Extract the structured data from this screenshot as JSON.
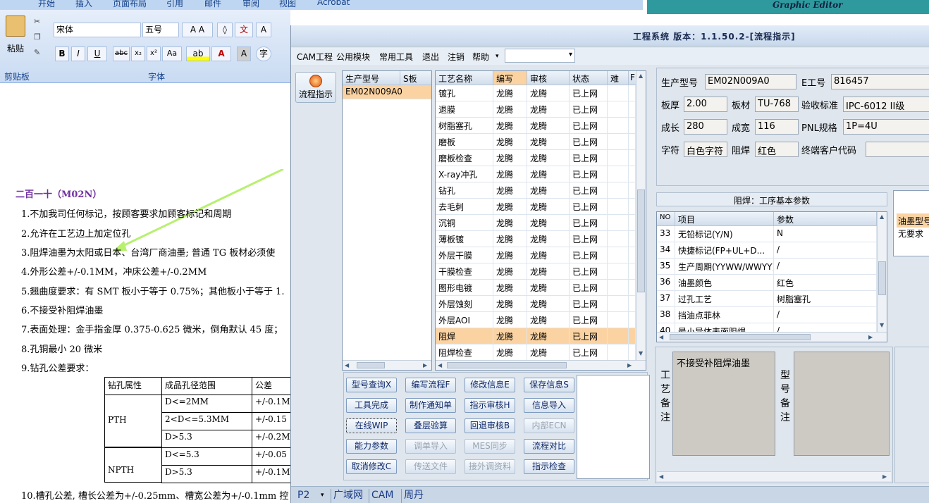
{
  "word": {
    "tabs": [
      "开始",
      "插入",
      "页面布局",
      "引用",
      "邮件",
      "审阅",
      "视图",
      "Acrobat"
    ],
    "font_name": "宋体",
    "font_size": "五号",
    "paste_label": "粘贴",
    "clipboard_group": "剪贴板",
    "font_group": "字体",
    "doc_heading": "二百一十（M02N）",
    "lines": [
      "1.不加我司任何标记，按顾客要求加顾客标记和周期",
      "2.允许在工艺边上加定位孔",
      "3.阻焊油墨为太阳或日本、台湾厂商油墨; 普通 TG 板材必须使",
      "4.外形公差+/-0.1MM，冲床公差+/-0.2MM",
      "5.翘曲度要求：有 SMT 板小于等于 0.75%；其他板小于等于 1.",
      "6.不接受补阻焊油墨",
      "7.表面处理：金手指金厚 0.375-0.625 微米，倒角默认 45 度；",
      "8.孔铜最小 20 微米",
      "9.钻孔公差要求："
    ],
    "last_line": "10.槽孔公差, 槽长公差为+/-0.25mm、槽宽公差为+/-0.1mm 控",
    "table": {
      "headers": [
        "钻孔属性",
        "成品孔径范围",
        "公差"
      ],
      "rows": [
        [
          "",
          "D<=2MM",
          "+/-0.1M"
        ],
        [
          "PTH",
          "2<D<=5.3MM",
          "+/-0.15"
        ],
        [
          "",
          "D>5.3",
          "+/-0.2M"
        ],
        [
          "",
          "D<=5.3",
          "+/-0.05"
        ],
        [
          "NPTH",
          "D>5.3",
          "+/-0.1M"
        ]
      ]
    }
  },
  "graphic_editor": {
    "title": "Graphic Editor"
  },
  "window": {
    "title": "工程系统 版本：1.1.50.2-[流程指示]",
    "menus": [
      "CAM工程",
      "公用模块",
      "常用工具",
      "退出",
      "注销",
      "帮助"
    ],
    "flow_button": "流程指示",
    "left_grid": {
      "headers": [
        "生产型号",
        "S板"
      ],
      "rows": [
        [
          "EM02N009A0",
          ""
        ]
      ]
    },
    "process_grid": {
      "headers": [
        "工艺名称",
        "编写",
        "审核",
        "状态",
        "难",
        "F"
      ],
      "rows": [
        [
          "镀孔",
          "龙腾",
          "龙腾",
          "已上网"
        ],
        [
          "退膜",
          "龙腾",
          "龙腾",
          "已上网"
        ],
        [
          "树脂塞孔",
          "龙腾",
          "龙腾",
          "已上网"
        ],
        [
          "磨板",
          "龙腾",
          "龙腾",
          "已上网"
        ],
        [
          "磨板检查",
          "龙腾",
          "龙腾",
          "已上网"
        ],
        [
          "X-ray冲孔",
          "龙腾",
          "龙腾",
          "已上网"
        ],
        [
          "钻孔",
          "龙腾",
          "龙腾",
          "已上网"
        ],
        [
          "去毛刺",
          "龙腾",
          "龙腾",
          "已上网"
        ],
        [
          "沉铜",
          "龙腾",
          "龙腾",
          "已上网"
        ],
        [
          "薄板镀",
          "龙腾",
          "龙腾",
          "已上网"
        ],
        [
          "外层干膜",
          "龙腾",
          "龙腾",
          "已上网"
        ],
        [
          "干膜检查",
          "龙腾",
          "龙腾",
          "已上网"
        ],
        [
          "图形电镀",
          "龙腾",
          "龙腾",
          "已上网"
        ],
        [
          "外层蚀刻",
          "龙腾",
          "龙腾",
          "已上网"
        ],
        [
          "外层AOI",
          "龙腾",
          "龙腾",
          "已上网"
        ],
        [
          "阻焊",
          "龙腾",
          "龙腾",
          "已上网"
        ],
        [
          "阻焊检查",
          "龙腾",
          "龙腾",
          "已上网"
        ]
      ],
      "selected_index": 15
    },
    "buttons": [
      [
        "型号查询X",
        "编写流程F",
        "修改信息E",
        "保存信息S"
      ],
      [
        "工具完成",
        "制作通知单",
        "指示审核H",
        "信息导入"
      ],
      [
        "在线WIP",
        "叠层验算",
        "回退审核B",
        "内部ECN"
      ],
      [
        "能力参数",
        "调单导入",
        "MES同步",
        "流程对比"
      ],
      [
        "取消修改C",
        "传送文件",
        "接外调资料",
        "指示检查"
      ]
    ],
    "disabled_buttons": [
      "内部ECN",
      "调单导入",
      "MES同步",
      "传送文件",
      "接外调资料"
    ],
    "info": {
      "model_label": "生产型号",
      "model": "EM02N009A0",
      "eno_label": "E工号",
      "eno": "816457",
      "thick_label": "板厚",
      "thick": "2.00",
      "mat_label": "板材",
      "mat": "TU-768",
      "std_label": "验收标准",
      "std": "IPC-6012 II级",
      "len_label": "成长",
      "len": "280",
      "wid_label": "成宽",
      "wid": "116",
      "pnl_label": "PNL规格",
      "pnl": "1P=4U",
      "char_label": "字符",
      "char": "白色字符",
      "mask_label": "阻焊",
      "mask": "红色",
      "cust_label": "终端客户代码",
      "cust": ""
    },
    "param": {
      "title": "阻焊：工序基本参数",
      "headers": [
        "NO",
        "项目",
        "参数"
      ],
      "rows": [
        [
          "33",
          "无铅标记(Y/N)",
          "N"
        ],
        [
          "34",
          "快捷标记(FP+UL+D...",
          "/"
        ],
        [
          "35",
          "生产周期(YYWW/WWYY)",
          "/"
        ],
        [
          "36",
          "油墨颜色",
          "红色"
        ],
        [
          "37",
          "过孔工艺",
          "树脂塞孔"
        ],
        [
          "38",
          "挡油点菲林",
          "/"
        ],
        [
          "40",
          "最小导体表面阻焊",
          "/"
        ]
      ]
    },
    "side": {
      "line1": "油墨型号",
      "line2": "无要求"
    },
    "remark": {
      "process_label": "工艺备注",
      "process_text": "不接受补阻焊油墨",
      "model_label": "型号备注",
      "model_text": ""
    },
    "bottom_tabs": [
      "P2",
      "广域网",
      "CAM",
      "周丹"
    ]
  }
}
